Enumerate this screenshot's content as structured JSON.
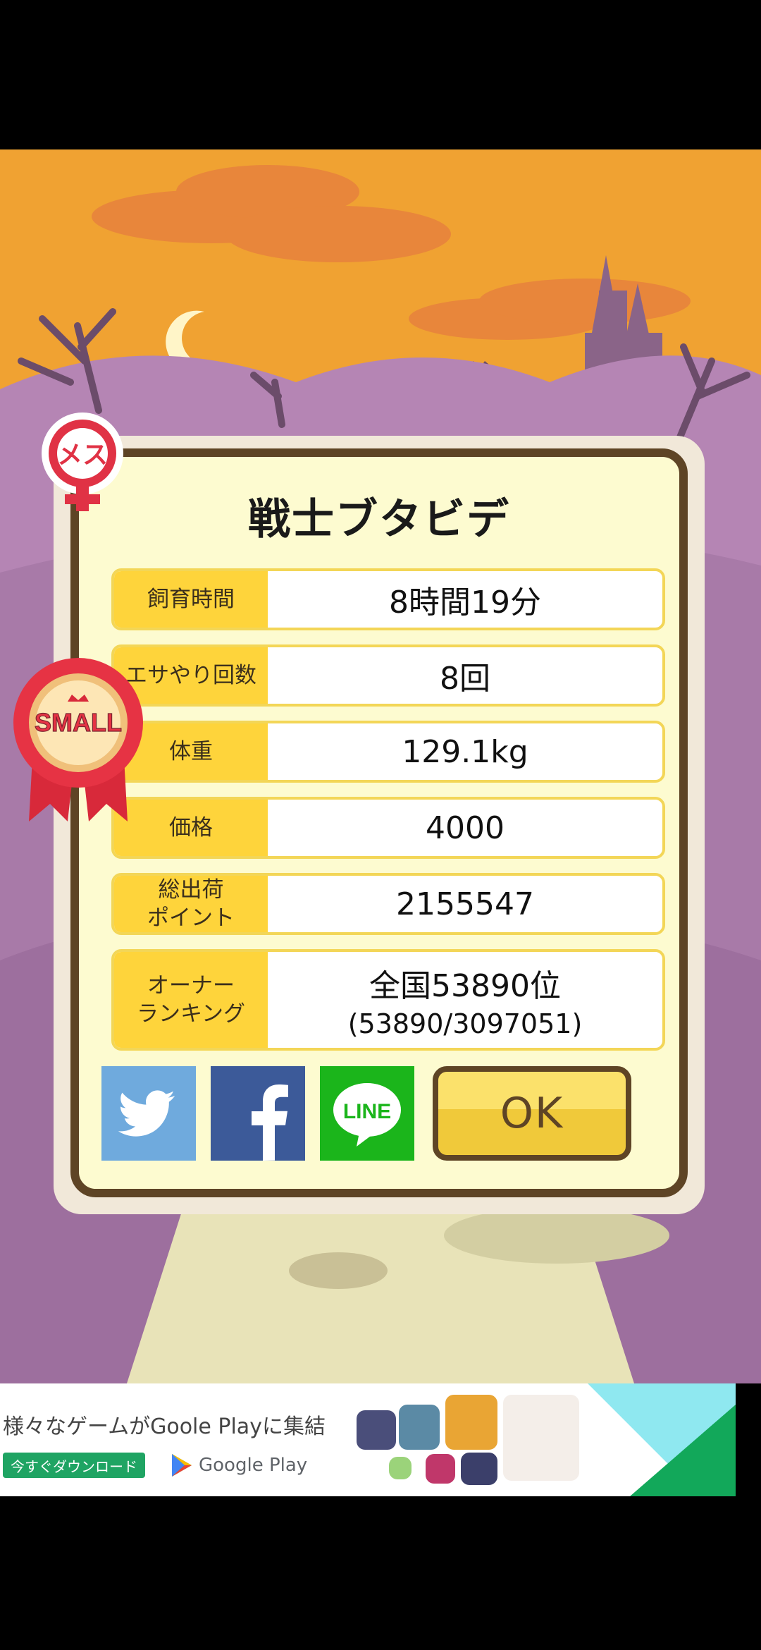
{
  "title": "戦士ブタビデ",
  "gender_badge": "メス",
  "size_ribbon": "SMALL",
  "stats": [
    {
      "label": "飼育時間",
      "value": "8時間19分",
      "sub": ""
    },
    {
      "label": "エサやり回数",
      "value": "8回",
      "sub": ""
    },
    {
      "label": "体重",
      "value": "129.1kg",
      "sub": ""
    },
    {
      "label": "価格",
      "value": "4000",
      "sub": ""
    },
    {
      "label": "総出荷\nポイント",
      "value": "2155547",
      "sub": ""
    },
    {
      "label": "オーナー\nランキング",
      "value": "全国53890位",
      "sub": "(53890/3097051)"
    }
  ],
  "share": {
    "line_label": "LINE"
  },
  "ok_label": "OK",
  "ad": {
    "headline": "様々なゲームがGoole Playに集結",
    "cta": "今すぐダウンロード",
    "store": "Google Play"
  },
  "colors": {
    "sky": "#f0a232",
    "hill": "#a87aa8",
    "panel": "#fdfbd0",
    "border": "#5e4425",
    "label_bg": "#fed43b"
  }
}
